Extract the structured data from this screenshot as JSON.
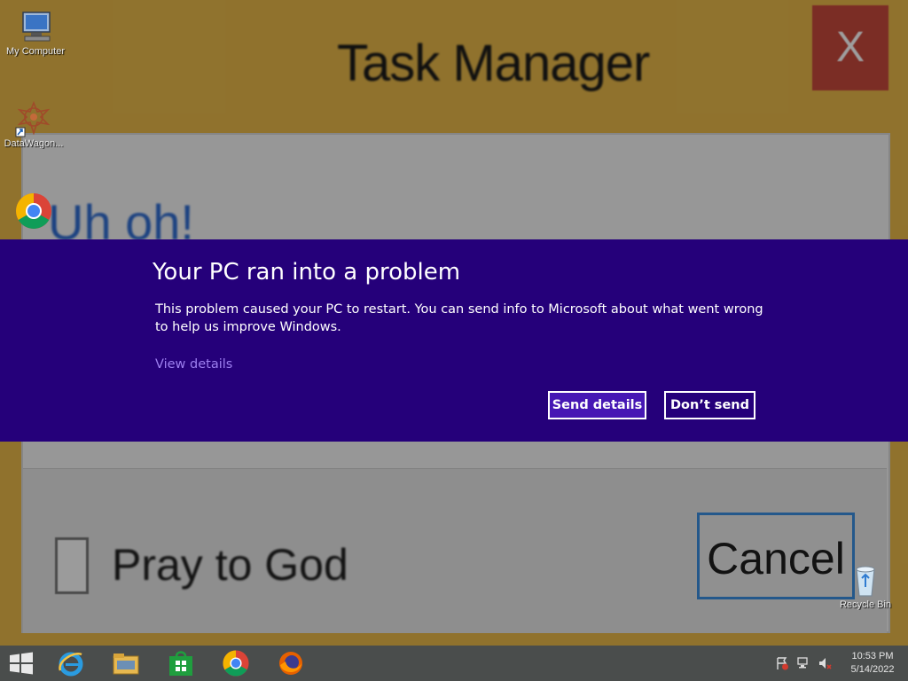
{
  "background_window": {
    "title": "Task Manager",
    "close_label": "X",
    "heading": "Uh oh!",
    "checkbox_label": "Pray to God",
    "cancel_label": "Cancel"
  },
  "desktop_icons": [
    {
      "label": "My Computer",
      "icon": "computer-icon"
    },
    {
      "label": "DataWagon...",
      "icon": "datawagon-icon"
    },
    {
      "label": "",
      "icon": "chrome-icon"
    },
    {
      "label": "Recycle Bin",
      "icon": "recycle-bin-icon"
    }
  ],
  "crash_dialog": {
    "title": "Your PC ran into a problem",
    "message": "This problem caused your PC to restart. You can send info to Microsoft about what went wrong to help us improve Windows.",
    "view_details": "View details",
    "send_button": "Send details",
    "dont_send_button": "Don’t send",
    "background_color": "#25007a"
  },
  "taskbar": {
    "pinned": [
      "windows-start-icon",
      "internet-explorer-icon",
      "file-explorer-icon",
      "store-icon",
      "chrome-icon",
      "firefox-icon"
    ],
    "clock_time": "10:53 PM",
    "clock_date": "5/14/2022"
  }
}
